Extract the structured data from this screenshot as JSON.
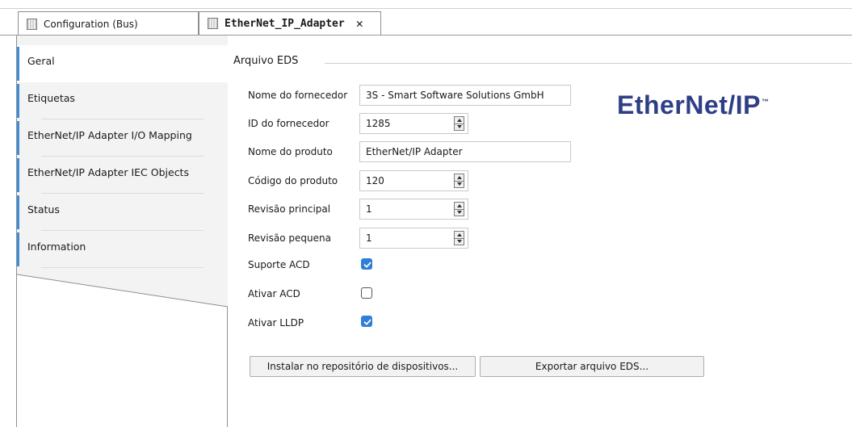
{
  "tabs": {
    "bus_label": "Configuration (Bus)",
    "adapter_label": "EtherNet_IP_Adapter",
    "close_glyph": "✕"
  },
  "sidebar": {
    "items": [
      {
        "label": "Geral"
      },
      {
        "label": "Etiquetas"
      },
      {
        "label": "EtherNet/IP Adapter I/O Mapping"
      },
      {
        "label": "EtherNet/IP Adapter IEC Objects"
      },
      {
        "label": "Status"
      },
      {
        "label": "Information"
      }
    ]
  },
  "main": {
    "group_title": "Arquivo EDS",
    "logo_text": "EtherNet/IP",
    "logo_tm": "™",
    "fields": {
      "vendor_name": {
        "label": "Nome do fornecedor",
        "value": "3S - Smart Software Solutions GmbH"
      },
      "vendor_id": {
        "label": "ID do fornecedor",
        "value": "1285"
      },
      "product_name": {
        "label": "Nome do produto",
        "value": "EtherNet/IP Adapter"
      },
      "product_code": {
        "label": "Código do produto",
        "value": "120"
      },
      "major_revision": {
        "label": "Revisão principal",
        "value": "1"
      },
      "minor_revision": {
        "label": "Revisão pequena",
        "value": "1"
      },
      "acd_support": {
        "label": "Suporte ACD",
        "checked": true
      },
      "acd_enable": {
        "label": "Ativar ACD",
        "checked": false
      },
      "lldp_enable": {
        "label": "Ativar LLDP",
        "checked": true
      }
    },
    "buttons": {
      "install": "Instalar no repositório de dispositivos...",
      "export": "Exportar arquivo EDS..."
    }
  },
  "colors": {
    "accent": "#2f7fd6",
    "logo": "#2f3f86",
    "nav_bar": "#3c8dd6"
  }
}
